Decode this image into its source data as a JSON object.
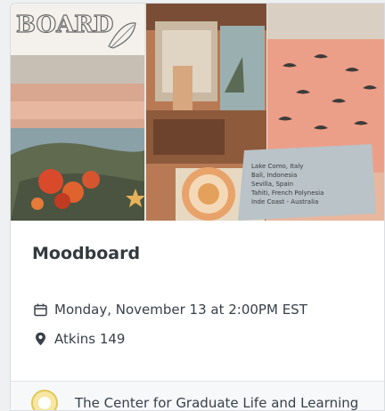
{
  "event": {
    "title": "Moodboard",
    "date": "Monday, November 13 at 2:00PM EST",
    "location": "Atkins 149"
  },
  "host": {
    "name": "The Center for Graduate Life and Learning"
  },
  "hero": {
    "board_label": "BOARD",
    "note_lines": [
      "Lake Como, Italy",
      "Bali, Indonesia",
      "Sevilla, Spain",
      "Tahiti, French Polynesia",
      "Inde Coast - Australia"
    ]
  },
  "icons": {
    "date": "calendar-icon",
    "location": "map-pin-icon"
  },
  "colors": {
    "title": "#333a3f",
    "text": "#39404a",
    "card_bg": "#ffffff",
    "page_bg": "#eef0f2"
  }
}
